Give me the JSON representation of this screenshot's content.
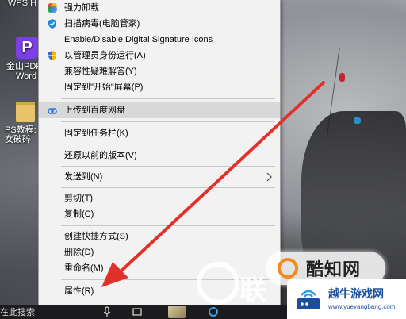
{
  "desktop": {
    "icons": [
      {
        "label_lines": [
          "WPS H"
        ]
      },
      {
        "label_lines": [
          "金山PDF",
          "Word"
        ]
      },
      {
        "label_lines": [
          "PS教程:",
          "女破碎"
        ]
      }
    ]
  },
  "context_menu": {
    "items": [
      {
        "label": "强力卸载",
        "icon": "colorful-circle-icon"
      },
      {
        "label": "扫描病毒(电脑管家)",
        "icon": "shield-icon"
      },
      {
        "label": "Enable/Disable Digital Signature Icons",
        "icon": ""
      },
      {
        "label": "以管理员身份运行(A)",
        "icon": "uac-shield-icon"
      },
      {
        "label": "兼容性疑难解答(Y)",
        "icon": ""
      },
      {
        "label": "固定到\"开始\"屏幕(P)",
        "icon": ""
      },
      {
        "label": "上传到百度网盘",
        "icon": "baidu-cloud-icon",
        "highlighted": true
      },
      {
        "label": "固定到任务栏(K)",
        "icon": ""
      },
      {
        "label": "还原以前的版本(V)",
        "icon": ""
      },
      {
        "label": "发送到(N)",
        "icon": "",
        "submenu": true
      },
      {
        "label": "剪切(T)",
        "icon": ""
      },
      {
        "label": "复制(C)",
        "icon": ""
      },
      {
        "label": "创建快捷方式(S)",
        "icon": ""
      },
      {
        "label": "删除(D)",
        "icon": ""
      },
      {
        "label": "重命名(M)",
        "icon": ""
      },
      {
        "label": "属性(R)",
        "icon": ""
      }
    ]
  },
  "watermarks": {
    "center": "联",
    "right": "酷知网",
    "badge_name": "越牛游戏网",
    "badge_url": "www.yueyangbang.com"
  },
  "taskbar": {
    "search_text": "在此搜索"
  },
  "colors": {
    "menu_bg": "#f2f2f2",
    "highlight": "#d8d8d8",
    "arrow": "#e0322b",
    "badge_blue": "#1a4fa0"
  }
}
